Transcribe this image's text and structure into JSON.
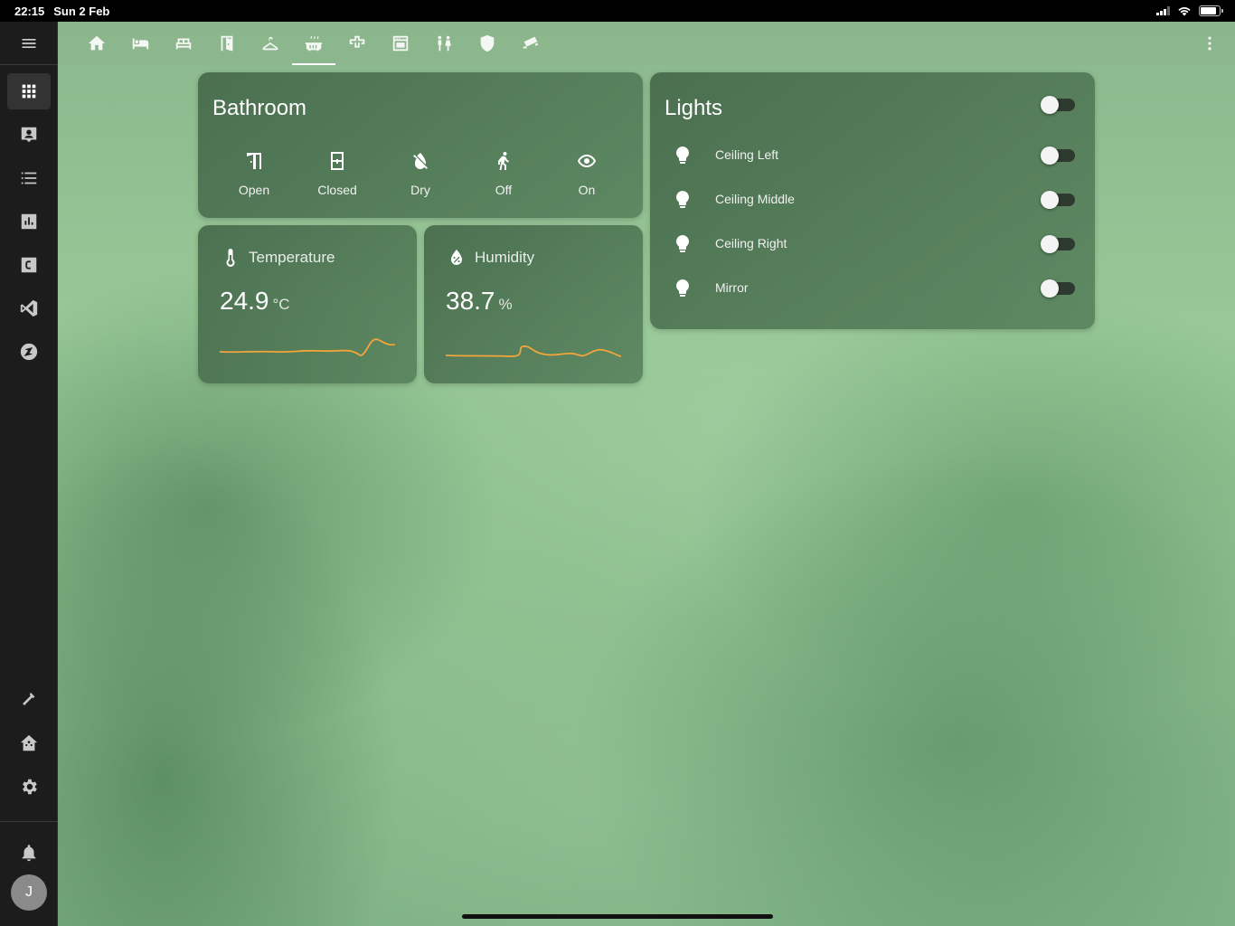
{
  "status_bar": {
    "time": "22:15",
    "date": "Sun 2 Feb"
  },
  "sidebar": {
    "menu_icon": "menu-icon",
    "items": [
      {
        "icon": "dashboard-grid-icon",
        "active": true
      },
      {
        "icon": "person-card-icon",
        "active": false
      },
      {
        "icon": "list-icon",
        "active": false
      },
      {
        "icon": "bar-chart-icon",
        "active": false
      },
      {
        "icon": "c-box-icon",
        "active": false
      },
      {
        "icon": "vscode-icon",
        "active": false
      },
      {
        "icon": "compass-icon",
        "active": false
      }
    ],
    "bottom_items": [
      {
        "icon": "hammer-icon"
      },
      {
        "icon": "home-assistant-icon"
      },
      {
        "icon": "gear-icon"
      },
      {
        "icon": "bell-icon"
      }
    ],
    "avatar_initial": "J"
  },
  "tabs": [
    {
      "icon": "home-icon"
    },
    {
      "icon": "bed-icon"
    },
    {
      "icon": "sofa-icon"
    },
    {
      "icon": "door-icon"
    },
    {
      "icon": "hanger-icon"
    },
    {
      "icon": "bathtub-icon",
      "active": true
    },
    {
      "icon": "puzzle-icon"
    },
    {
      "icon": "stove-icon"
    },
    {
      "icon": "family-icon"
    },
    {
      "icon": "shield-icon"
    },
    {
      "icon": "cctv-icon"
    }
  ],
  "bathroom_card": {
    "title": "Bathroom",
    "entities": [
      {
        "label": "Open",
        "icon": "door-open-icon"
      },
      {
        "label": "Closed",
        "icon": "window-closed-icon"
      },
      {
        "label": "Dry",
        "icon": "water-off-icon"
      },
      {
        "label": "Off",
        "icon": "walk-icon"
      },
      {
        "label": "On",
        "icon": "eye-icon"
      }
    ]
  },
  "temperature_card": {
    "name": "Temperature",
    "value": "24.9",
    "unit": "°C",
    "icon": "thermometer-icon",
    "accent": "#f2a53a"
  },
  "humidity_card": {
    "name": "Humidity",
    "value": "38.7",
    "unit": "%",
    "icon": "water-percent-icon",
    "accent": "#f2a53a"
  },
  "lights_card": {
    "title": "Lights",
    "master_on": false,
    "items": [
      {
        "name": "Ceiling Left",
        "on": false
      },
      {
        "name": "Ceiling Middle",
        "on": false
      },
      {
        "name": "Ceiling Right",
        "on": false
      },
      {
        "name": "Mirror",
        "on": false
      }
    ]
  }
}
